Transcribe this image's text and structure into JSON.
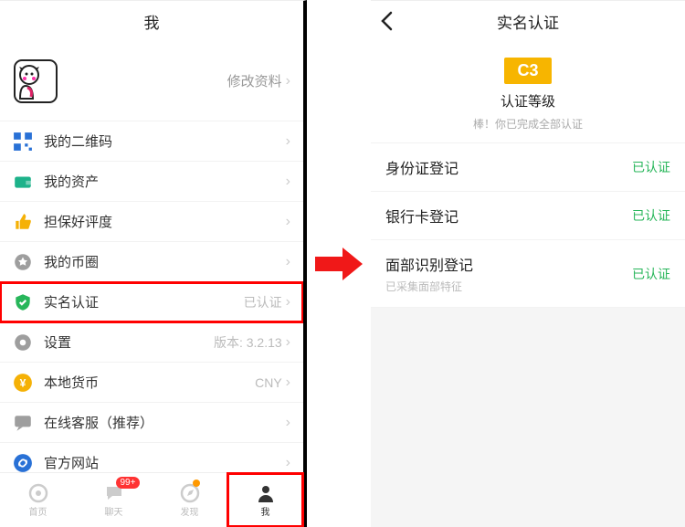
{
  "left": {
    "header_title": "我",
    "profile_edit": "修改资料",
    "menu": [
      {
        "icon": "qr-icon",
        "color": "#2971d6",
        "label": "我的二维码",
        "value": ""
      },
      {
        "icon": "wallet-icon",
        "color": "#1db28a",
        "label": "我的资产",
        "value": ""
      },
      {
        "icon": "thumb-icon",
        "color": "#f5b106",
        "label": "担保好评度",
        "value": ""
      },
      {
        "icon": "circle-icon",
        "color": "#9e9e9e",
        "label": "我的币圈",
        "value": ""
      },
      {
        "icon": "shield-icon",
        "color": "#27b65a",
        "label": "实名认证",
        "value": "已认证",
        "highlight": true
      },
      {
        "icon": "gear-icon",
        "color": "#9e9e9e",
        "label": "设置",
        "value": "版本: 3.2.13"
      },
      {
        "icon": "coin-icon",
        "color": "#f5b106",
        "label": "本地货币",
        "value": "CNY"
      },
      {
        "icon": "chat-icon",
        "color": "#9e9e9e",
        "label": "在线客服（推荐）",
        "value": ""
      },
      {
        "icon": "link-icon",
        "color": "#2971d6",
        "label": "官方网站",
        "value": ""
      }
    ],
    "tabs": [
      {
        "name": "home",
        "label": "首页",
        "badge": ""
      },
      {
        "name": "chat",
        "label": "聊天",
        "badge": "99+"
      },
      {
        "name": "discover",
        "label": "发现",
        "badge": ""
      },
      {
        "name": "me",
        "label": "我",
        "badge": "",
        "active": true,
        "highlight": true
      }
    ]
  },
  "right": {
    "header_title": "实名认证",
    "cert_badge": "C3",
    "cert_level": "认证等级",
    "cert_msg": "棒！你已完成全部认证",
    "items": [
      {
        "title": "身份证登记",
        "sub": "",
        "status": "已认证"
      },
      {
        "title": "银行卡登记",
        "sub": "",
        "status": "已认证"
      },
      {
        "title": "面部识别登记",
        "sub": "已采集面部特征",
        "status": "已认证"
      }
    ]
  }
}
